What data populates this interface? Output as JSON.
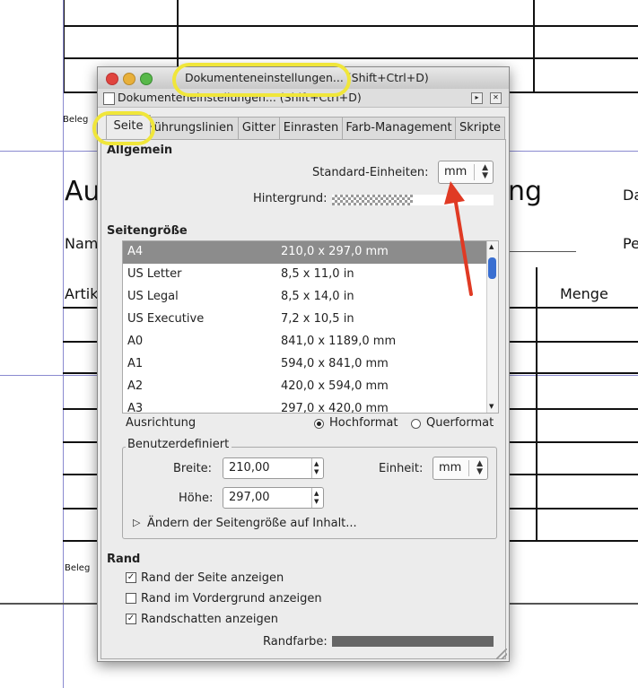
{
  "background_doc": {
    "title_left": "Au",
    "title_right": "ng",
    "text_da": "Da",
    "text_nam": "Nam",
    "text_pe": "Pe",
    "text_artik": "Artik",
    "text_menge": "Menge",
    "beleg1": "Beleg",
    "beleg2": "Beleg"
  },
  "window": {
    "title": "Dokumenteneinstellungen... (Shift+Ctrl+D)",
    "dock_title": "Dokumenteneinstellungen... (Shift+Ctrl+D)",
    "close_glyph": "✕",
    "menu_glyph": "▸"
  },
  "tabs": [
    {
      "label": "Seite",
      "active": true
    },
    {
      "label": "Führungslinien",
      "active": false
    },
    {
      "label": "Gitter",
      "active": false
    },
    {
      "label": "Einrasten",
      "active": false
    },
    {
      "label": "Farb-Management",
      "active": false
    },
    {
      "label": "Skripte",
      "active": false
    }
  ],
  "general": {
    "heading": "Allgemein",
    "units_label": "Standard-Einheiten:",
    "units_value": "mm",
    "background_label": "Hintergrund:"
  },
  "page_size": {
    "heading": "Seitengröße",
    "rows": [
      {
        "name": "A4",
        "size": "210,0 x 297,0 mm"
      },
      {
        "name": "US Letter",
        "size": "8,5 x 11,0 in"
      },
      {
        "name": "US Legal",
        "size": "8,5 x 14,0 in"
      },
      {
        "name": "US Executive",
        "size": "7,2 x 10,5 in"
      },
      {
        "name": "A0",
        "size": "841,0 x 1189,0 mm"
      },
      {
        "name": "A1",
        "size": "594,0 x 841,0 mm"
      },
      {
        "name": "A2",
        "size": "420,0 x 594,0 mm"
      },
      {
        "name": "A3",
        "size": "297,0 x 420,0 mm"
      }
    ],
    "selected_index": 0
  },
  "orientation": {
    "label": "Ausrichtung",
    "portrait": "Hochformat",
    "landscape": "Querformat",
    "selected": "portrait"
  },
  "custom": {
    "heading": "Benutzerdefiniert",
    "width_label": "Breite:",
    "width_value": "210,00",
    "height_label": "Höhe:",
    "height_value": "297,00",
    "unit_label": "Einheit:",
    "unit_value": "mm",
    "fit_label": "Ändern der Seitengröße auf Inhalt..."
  },
  "border": {
    "heading": "Rand",
    "show_border": "Rand der Seite anzeigen",
    "show_border_checked": true,
    "border_on_top": "Rand im Vordergrund anzeigen",
    "border_on_top_checked": false,
    "shadow": "Randschatten anzeigen",
    "shadow_checked": true,
    "color_label": "Randfarbe:"
  },
  "colors": {
    "highlight": "#f0e63a",
    "arrow": "#e03a24",
    "selection": "#8c8c8c",
    "scroll_thumb": "#3a6fd1"
  }
}
